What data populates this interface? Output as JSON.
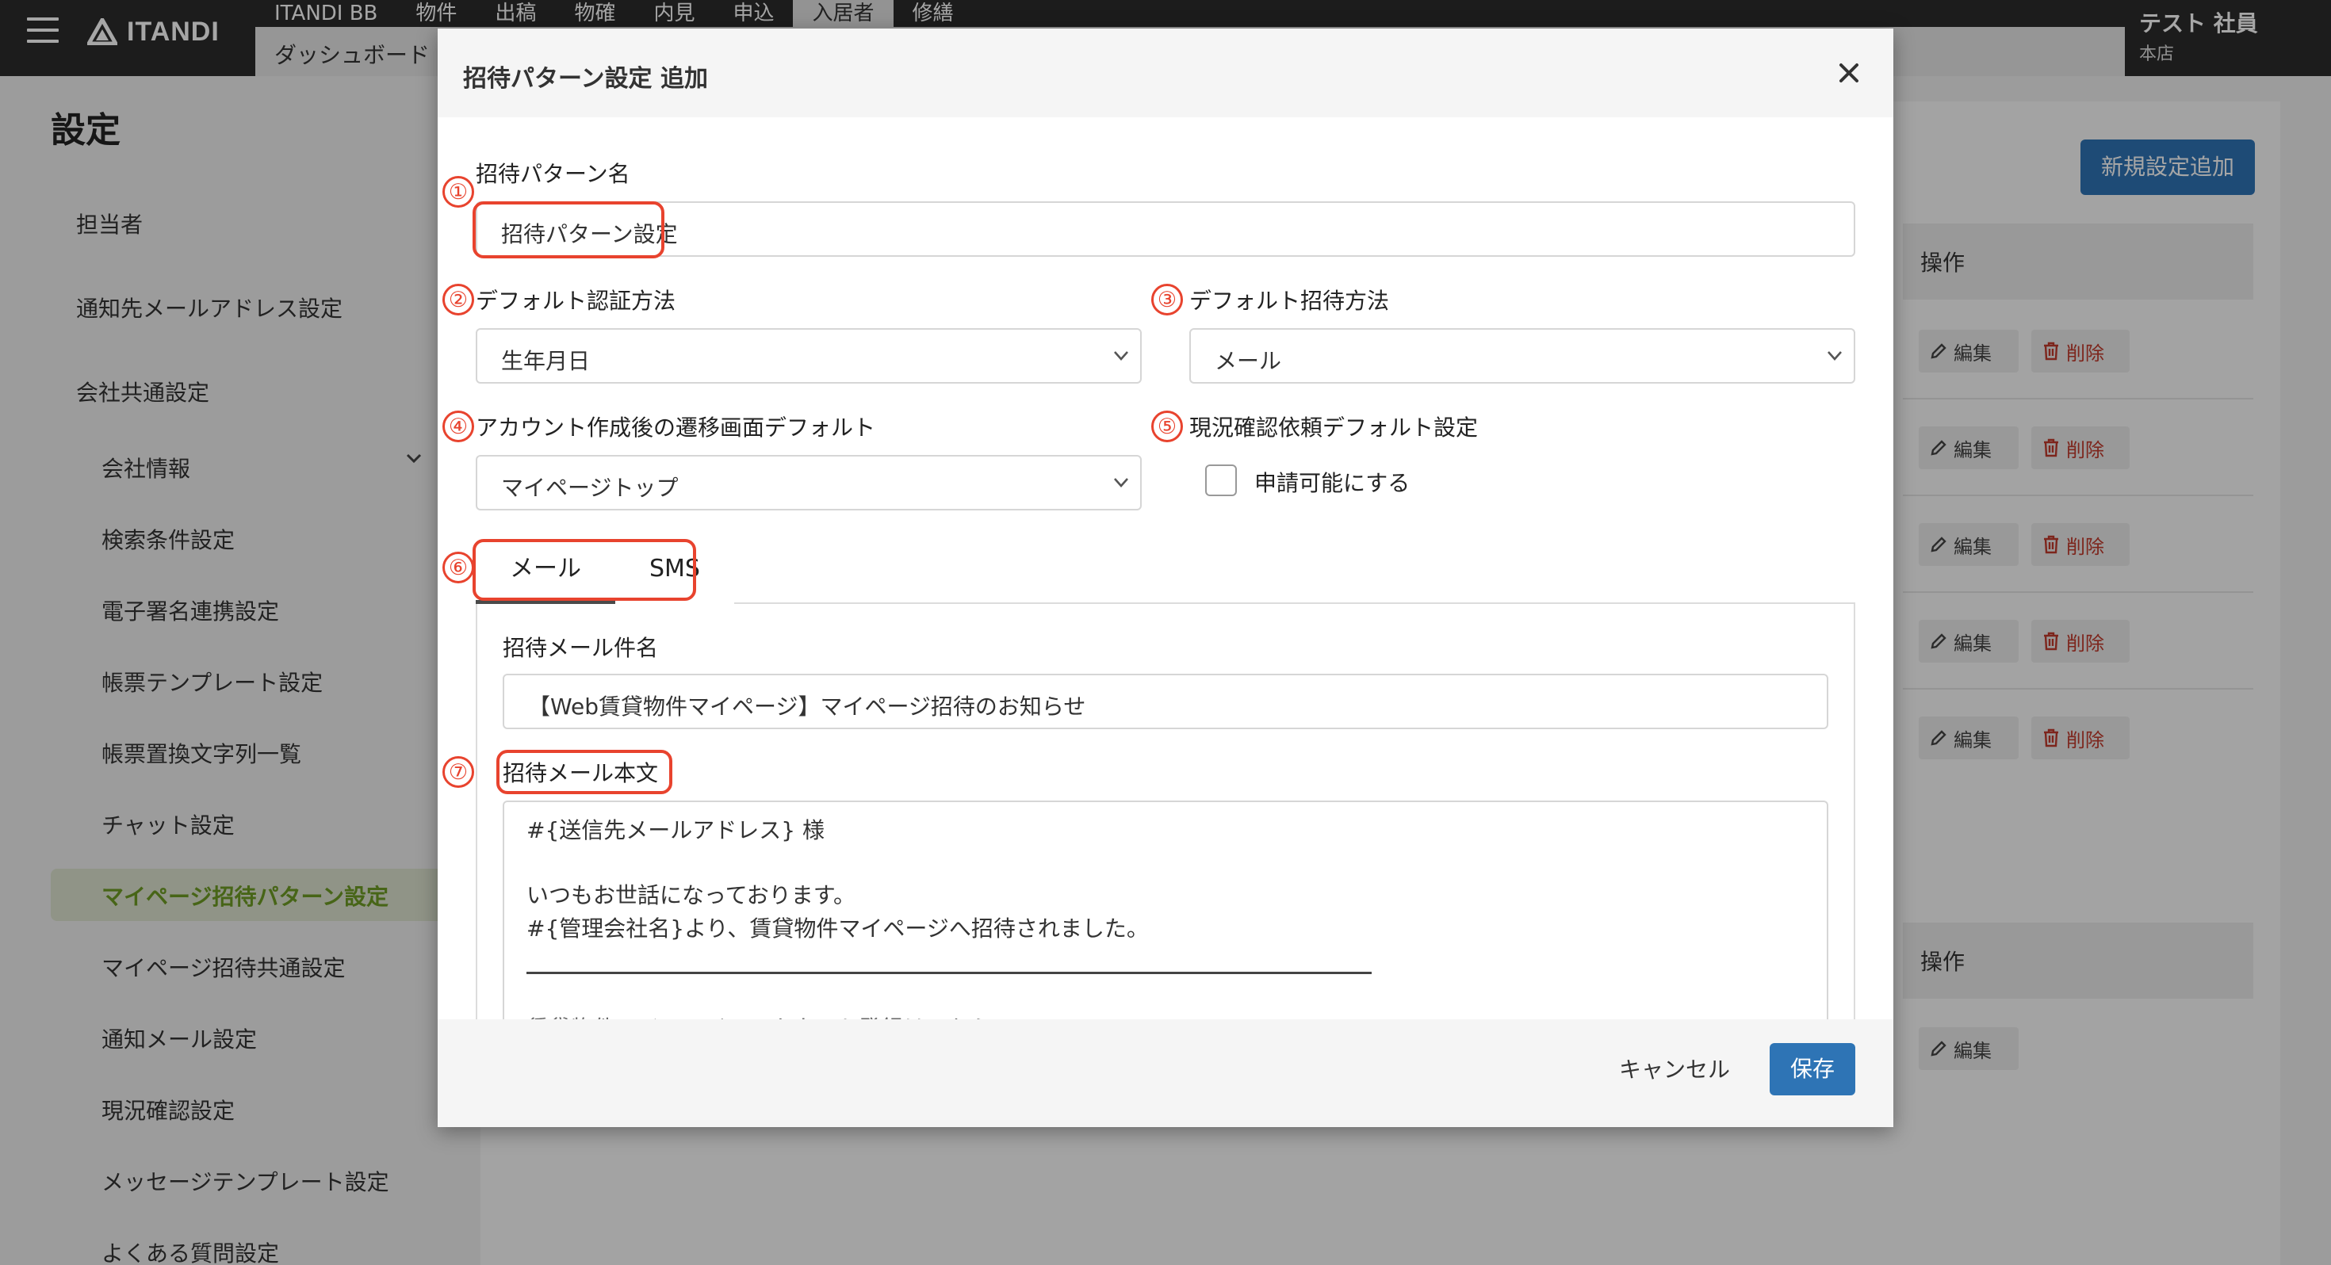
{
  "header": {
    "logo": "ITANDI",
    "nav": [
      "ITANDI BB",
      "物件",
      "出稿",
      "物確",
      "内見",
      "申込",
      "入居者",
      "修繕"
    ],
    "active_nav": "入居者",
    "subnav": "ダッシュボード",
    "user_name": "テスト 社員",
    "user_branch": "本店"
  },
  "sidebar": {
    "title": "設定",
    "items": [
      "担当者",
      "通知先メールアドレス設定",
      "会社共通設定",
      "会社情報",
      "検索条件設定",
      "電子署名連携設定",
      "帳票テンプレート設定",
      "帳票置換文字列一覧",
      "チャット設定",
      "マイページ招待パターン設定",
      "マイページ招待共通設定",
      "通知メール設定",
      "現況確認設定",
      "メッセージテンプレート設定",
      "よくある質問設定"
    ]
  },
  "background": {
    "new_button": "新規設定追加",
    "col_ops": "操作",
    "edit": "編集",
    "delete": "削除"
  },
  "modal": {
    "title": "招待パターン設定 追加",
    "pattern_name_label": "招待パターン名",
    "pattern_name_value": "招待パターン設定",
    "auth_label": "デフォルト認証方法",
    "auth_value": "生年月日",
    "invite_label": "デフォルト招待方法",
    "invite_value": "メール",
    "redirect_label": "アカウント作成後の遷移画面デフォルト",
    "redirect_value": "マイページトップ",
    "status_label": "現況確認依頼デフォルト設定",
    "status_checkbox": "申請可能にする",
    "tabs": [
      "メール",
      "SMS"
    ],
    "subject_label": "招待メール件名",
    "subject_value": "【Web賃貸物件マイページ】マイページ招待のお知らせ",
    "body_label": "招待メール本文",
    "body_lines": [
      "#{送信先メールアドレス} 様",
      "いつもお世話になっております。",
      "#{管理会社名}より、賃貸物件マイページへ招待されました。",
      "賃貸物件マイページのアカウント登録はこちら"
    ],
    "cancel": "キャンセル",
    "save": "保存"
  },
  "annotations": [
    "①",
    "②",
    "③",
    "④",
    "⑤",
    "⑥",
    "⑦"
  ],
  "colors": {
    "accent": "#2e74b5",
    "annotation": "#e8432e",
    "active_sidebar": "#6e9c24"
  }
}
